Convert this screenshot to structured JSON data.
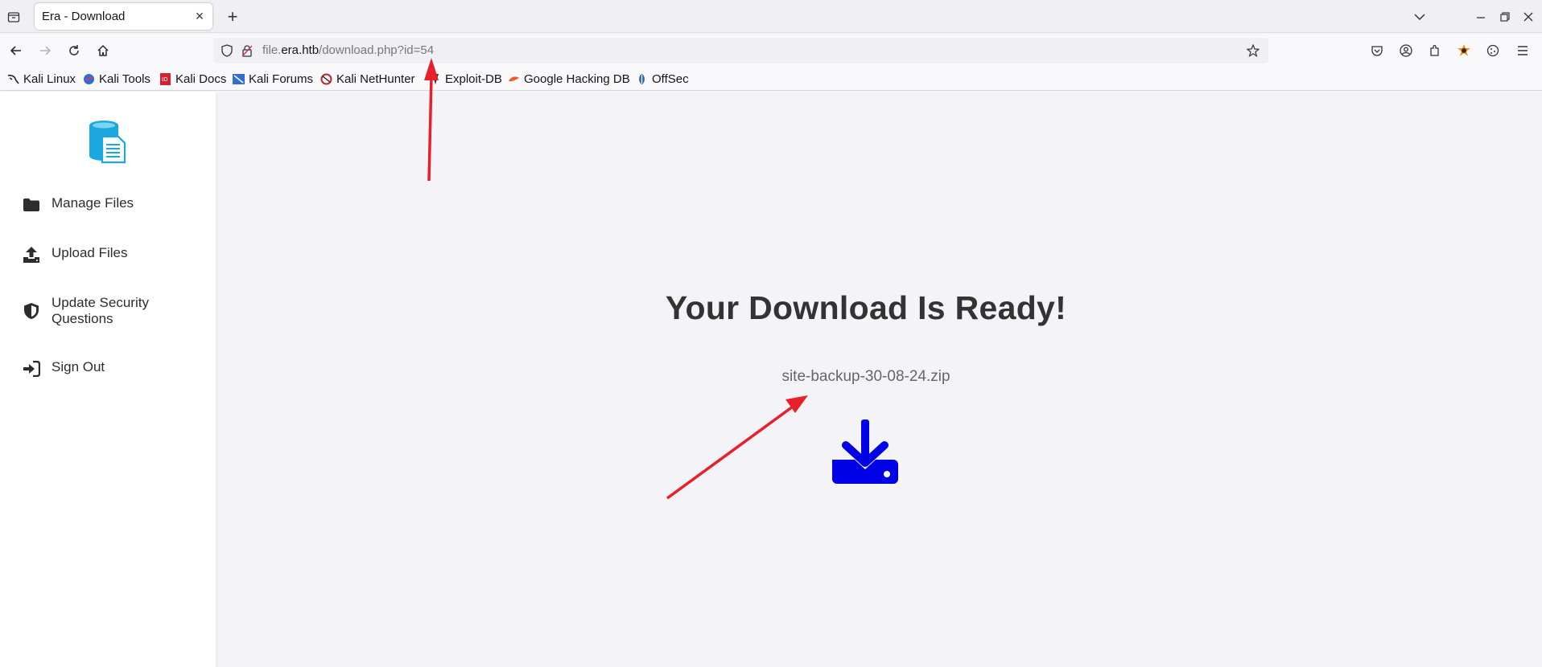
{
  "browser": {
    "tab_title": "Era - Download",
    "url": {
      "prefix": "file.",
      "host": "era.htb",
      "path": "/download.php?id=54"
    },
    "bookmarks": [
      {
        "label": "Kali Linux",
        "icon": "kali-dragon-icon"
      },
      {
        "label": "Kali Tools",
        "icon": "kali-tools-icon"
      },
      {
        "label": "Kali Docs",
        "icon": "kali-docs-icon"
      },
      {
        "label": "Kali Forums",
        "icon": "kali-forums-icon"
      },
      {
        "label": "Kali NetHunter",
        "icon": "kali-nethunter-icon"
      },
      {
        "label": "Exploit-DB",
        "icon": "exploit-db-icon"
      },
      {
        "label": "Google Hacking DB",
        "icon": "ghdb-icon"
      },
      {
        "label": "OffSec",
        "icon": "offsec-icon"
      }
    ]
  },
  "sidebar": {
    "logo": "file-database-icon",
    "items": [
      {
        "label": "Manage Files",
        "icon": "folder-icon"
      },
      {
        "label": "Upload Files",
        "icon": "upload-icon"
      },
      {
        "label": "Update Security Questions",
        "icon": "shield-icon"
      },
      {
        "label": "Sign Out",
        "icon": "sign-out-icon"
      }
    ]
  },
  "main": {
    "heading": "Your Download Is Ready!",
    "filename": "site-backup-30-08-24.zip",
    "download_icon": "download-icon"
  },
  "colors": {
    "accent_blue": "#0000e6",
    "logo_cyan": "#1ba8e0",
    "annotation_red": "#e8202a",
    "page_bg": "#f4f4f8"
  }
}
